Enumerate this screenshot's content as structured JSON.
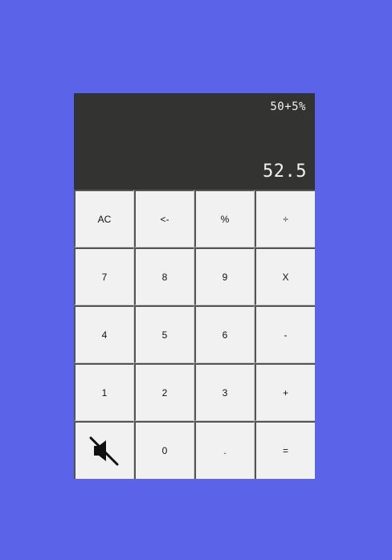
{
  "display": {
    "expression": "50+5%",
    "result": "52.5"
  },
  "keys": [
    {
      "label": "AC"
    },
    {
      "label": "<-"
    },
    {
      "label": "%"
    },
    {
      "label": "÷"
    },
    {
      "label": "7"
    },
    {
      "label": "8"
    },
    {
      "label": "9"
    },
    {
      "label": "X"
    },
    {
      "label": "4"
    },
    {
      "label": "5"
    },
    {
      "label": "6"
    },
    {
      "label": "-"
    },
    {
      "label": "1"
    },
    {
      "label": "2"
    },
    {
      "label": "3"
    },
    {
      "label": "+"
    },
    {
      "icon": "volume-mute-icon"
    },
    {
      "label": "0"
    },
    {
      "label": "."
    },
    {
      "label": "="
    }
  ],
  "colors": {
    "background": "#5b63e8",
    "display_background": "#333331",
    "display_text": "#f2f2f2",
    "key_background": "#f1f1f1",
    "key_border": "#cfcfcf",
    "key_text": "#111111"
  }
}
